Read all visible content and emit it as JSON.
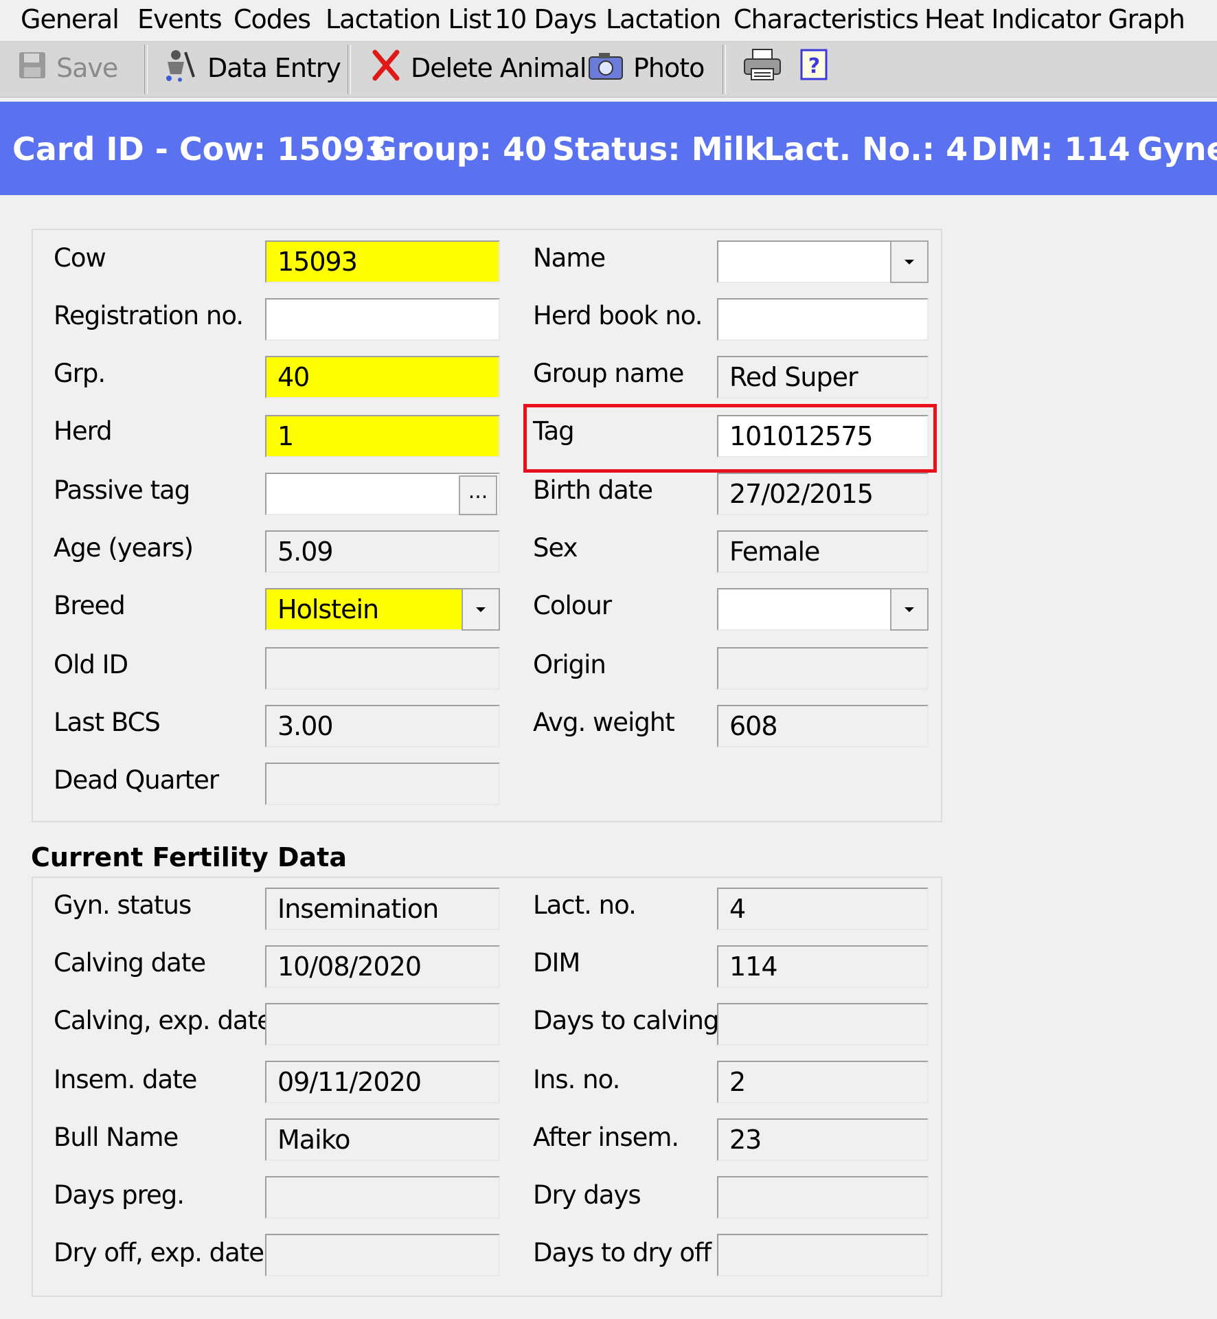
{
  "tabs": [
    "General",
    "Events",
    "Codes",
    "Lactation List",
    "10 Days",
    "Lactation",
    "Characteristics",
    "Heat Indicator Graph"
  ],
  "toolbar": {
    "save": "Save",
    "data_entry": "Data Entry",
    "delete_animal": "Delete Animal",
    "photo": "Photo"
  },
  "header": {
    "card_id": "Card ID - Cow: 15093",
    "group": "Group: 40",
    "status": "Status: Milk",
    "lact_no": "Lact. No.: 4",
    "dim": "DIM: 114",
    "gyn": "Gyne"
  },
  "general": {
    "cow": {
      "label": "Cow",
      "value": "15093"
    },
    "registration_no": {
      "label": "Registration no.",
      "value": ""
    },
    "grp": {
      "label": "Grp.",
      "value": "40"
    },
    "herd": {
      "label": "Herd",
      "value": "1"
    },
    "passive_tag": {
      "label": "Passive tag",
      "value": "",
      "button": "..."
    },
    "age": {
      "label": "Age (years)",
      "value": "5.09"
    },
    "breed": {
      "label": "Breed",
      "value": "Holstein"
    },
    "old_id": {
      "label": "Old ID",
      "value": ""
    },
    "last_bcs": {
      "label": "Last BCS",
      "value": "3.00"
    },
    "dead_quarter": {
      "label": "Dead Quarter",
      "value": ""
    },
    "name": {
      "label": "Name",
      "value": ""
    },
    "herd_book_no": {
      "label": "Herd book no.",
      "value": ""
    },
    "group_name": {
      "label": "Group name",
      "value": "Red Super"
    },
    "tag": {
      "label": "Tag",
      "value": "101012575"
    },
    "birth_date": {
      "label": "Birth date",
      "value": "27/02/2015"
    },
    "sex": {
      "label": "Sex",
      "value": "Female"
    },
    "colour": {
      "label": "Colour",
      "value": ""
    },
    "origin": {
      "label": "Origin",
      "value": ""
    },
    "avg_weight": {
      "label": "Avg. weight",
      "value": "608"
    }
  },
  "fertility": {
    "title": "Current Fertility Data",
    "gyn_status": {
      "label": "Gyn. status",
      "value": "Insemination"
    },
    "calving_date": {
      "label": "Calving date",
      "value": "10/08/2020"
    },
    "calving_exp_date": {
      "label": "Calving, exp. date",
      "value": ""
    },
    "insem_date": {
      "label": "Insem. date",
      "value": "09/11/2020"
    },
    "bull_name": {
      "label": "Bull Name",
      "value": "Maiko"
    },
    "days_preg": {
      "label": "Days preg.",
      "value": ""
    },
    "dry_off_exp_date": {
      "label": "Dry off, exp. date",
      "value": ""
    },
    "lact_no": {
      "label": "Lact. no.",
      "value": "4"
    },
    "dim": {
      "label": "DIM",
      "value": "114"
    },
    "days_to_calving": {
      "label": "Days to calving",
      "value": ""
    },
    "ins_no": {
      "label": "Ins. no.",
      "value": "2"
    },
    "after_insem": {
      "label": "After insem.",
      "value": "23"
    },
    "dry_days": {
      "label": "Dry days",
      "value": ""
    },
    "days_to_dry_off": {
      "label": "Days to dry off",
      "value": ""
    }
  },
  "colors": {
    "header_bg": "#5a72f0",
    "required_field": "#ffff00",
    "highlight_box": "#e8101c"
  }
}
